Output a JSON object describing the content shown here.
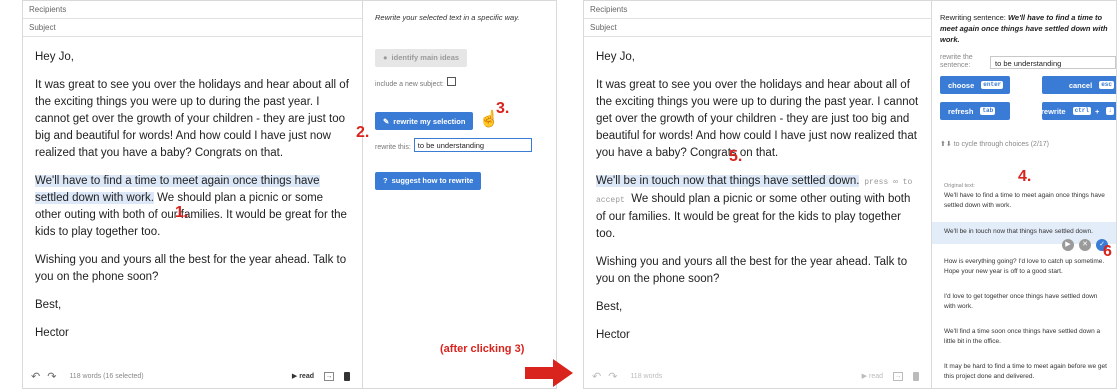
{
  "left": {
    "recipients_label": "Recipients",
    "subject_label": "Subject",
    "body": {
      "greeting": "Hey Jo,",
      "para1": "It was great to see you over the holidays and hear about all of the exciting things you were up to during the past year. I cannot get over the growth of your children - they are just too big and beautiful for words! And how could I have just now realized that you have a baby? Congrats on that.",
      "para2_selected": "We'll have to find a time to meet again once things have settled down with work.",
      "para2_rest": " We should plan a picnic or some other outing with both of our families. It would be great for the kids to play together too.",
      "para3": "Wishing you and yours all the best for the year ahead. Talk to you on the phone soon?",
      "signoff": "Best,",
      "name": "Hector"
    },
    "footer": {
      "undo_icon": "undo-icon",
      "redo_icon": "redo-icon",
      "word_count": "118 words (16 selected)",
      "read_label": "read",
      "trash_icon": "trash-icon"
    },
    "side": {
      "title": "Rewrite your selected text in a specific way.",
      "identify_main_ideas": "identify main ideas",
      "include_subject_label": "include a new subject:",
      "rewrite_selection": "rewrite my selection",
      "rewrite_this_label": "rewrite this:",
      "rewrite_this_value": "to be understanding",
      "suggest_how": "suggest how to rewrite"
    }
  },
  "right": {
    "recipients_label": "Recipients",
    "subject_label": "Subject",
    "body": {
      "greeting": "Hey Jo,",
      "para1": "It was great to see you over the holidays and hear about all of the exciting things you were up to during the past year. I cannot get over the growth of your children - they are just too big and beautiful for words! And how could I have just now realized that you have a baby? Congrats on that.",
      "para2_rewritten": "We'll be in touch now that things have settled down.",
      "press_hint": " press ",
      "accept_hint": " to accept",
      "para2_rest": "We should plan a picnic or some other outing with both of our families. It would be great for the kids to play together too.",
      "para3": "Wishing you and yours all the best for the year ahead. Talk to you on the phone soon?",
      "signoff": "Best,",
      "name": "Hector"
    },
    "footer": {
      "word_count": "118 words",
      "read_label": "read"
    },
    "side": {
      "header_prefix": "Rewriting sentence: ",
      "header_sentence": "We'll have to find a time to meet again once things have settled down with work.",
      "rewrite_the_sentence_label": "rewrite the sentence:",
      "rewrite_value": "to be understanding",
      "choose": "choose",
      "choose_key": "enter",
      "cancel": "cancel",
      "cancel_key": "esc",
      "refresh": "refresh",
      "refresh_key": "tab",
      "rewrite": "rewrite",
      "rewrite_key1": "ctrl",
      "rewrite_plus": "+",
      "rewrite_key2": "↓",
      "cycle_hint": "to cycle through choices (2/17)",
      "original_label": "Original text:",
      "original_text": "We'll have to find a time to meet again once things have settled down with work.",
      "choices": [
        "We'll be in touch now that things have settled down.",
        "How is everything going? I'd love to catch up sometime. Hope your new year is off to a good start.",
        "I'd love to get together once things have settled down with work.",
        "We'll find a time soon once things have settled down a little bit in the office.",
        "It may be hard to find a time to meet again before we get this project done and delivered."
      ]
    }
  },
  "annotations": {
    "n1": "1.",
    "n2": "2.",
    "n3": "3.",
    "n4": "4.",
    "n5": "5.",
    "n6": "6",
    "after_clicking": "(after clicking 3)"
  },
  "colors": {
    "accent": "#3a7bd5",
    "highlight": "#dce8f7",
    "annotation": "#d9231d"
  }
}
